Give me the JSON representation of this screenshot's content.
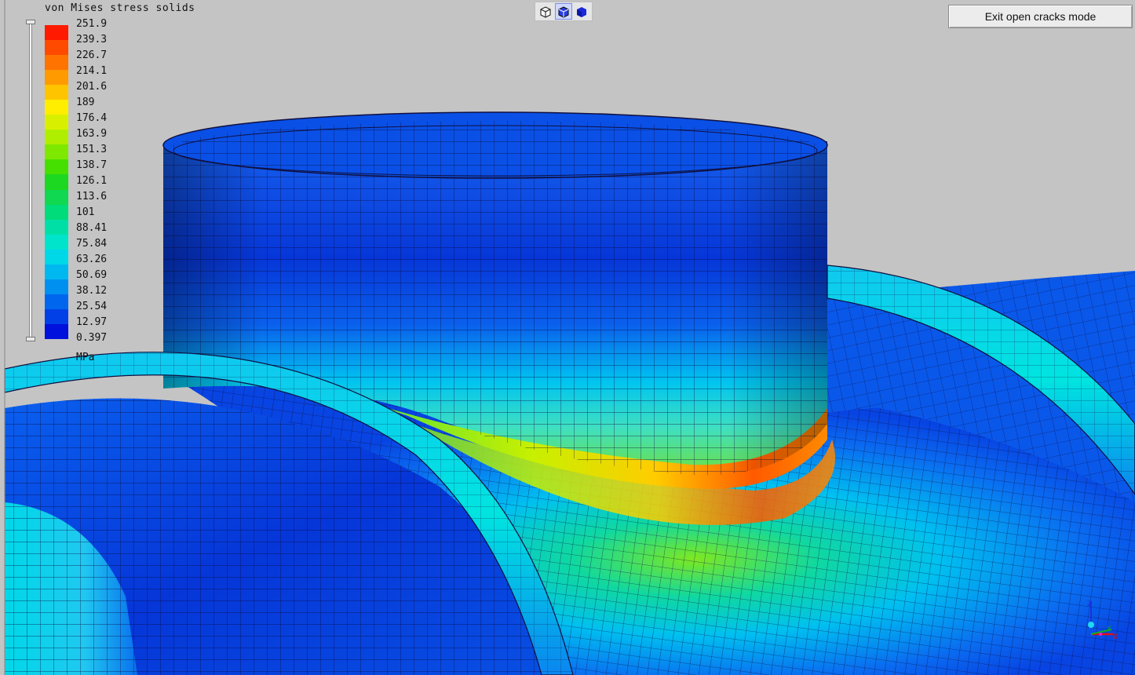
{
  "legend": {
    "title": "von Mises stress solids",
    "unit": "MPa",
    "labels": [
      "251.9",
      "239.3",
      "226.7",
      "214.1",
      "201.6",
      "189",
      "176.4",
      "163.9",
      "151.3",
      "138.7",
      "126.1",
      "113.6",
      "101",
      "88.41",
      "75.84",
      "63.26",
      "50.69",
      "38.12",
      "25.54",
      "12.97",
      "0.397"
    ],
    "colors": [
      "#ff1a00",
      "#ff4a00",
      "#ff7300",
      "#ff9a00",
      "#ffc400",
      "#ffee00",
      "#d8f000",
      "#b0ee00",
      "#7ee800",
      "#46e000",
      "#1cd820",
      "#10d850",
      "#00dc7a",
      "#00e0a6",
      "#00e4cc",
      "#00d8e8",
      "#00b8f0",
      "#0090f0",
      "#0066ee",
      "#0040e6",
      "#0010dd"
    ]
  },
  "toolbar": {
    "buttons": [
      {
        "name": "wireframe-view-icon",
        "active": false
      },
      {
        "name": "shaded-edges-view-icon",
        "active": true
      },
      {
        "name": "solid-view-icon",
        "active": false
      }
    ]
  },
  "exit_button": {
    "label": "Exit open cracks mode"
  },
  "triad": {
    "z": "Z",
    "y": "Y",
    "x": "X"
  }
}
